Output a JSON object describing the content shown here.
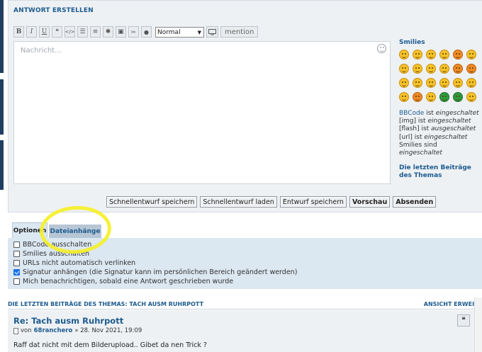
{
  "panel": {
    "title": "ANTWORT ERSTELLEN"
  },
  "toolbar": {
    "buttons": [
      {
        "label": "B",
        "icon": "bold"
      },
      {
        "label": "I",
        "icon": "italic"
      },
      {
        "label": "U",
        "icon": "underline"
      },
      {
        "label": "❝",
        "icon": "quote"
      },
      {
        "label": "</>",
        "icon": "code"
      },
      {
        "label": "☰",
        "icon": "list-bullet"
      },
      {
        "label": "≡",
        "icon": "list-numbered"
      },
      {
        "label": "✱",
        "icon": "star"
      },
      {
        "label": "▣",
        "icon": "image"
      },
      {
        "label": "✂",
        "icon": "link"
      },
      {
        "label": "●",
        "icon": "color-drop"
      }
    ],
    "font_size_value": "Normal",
    "mention_label": "mention"
  },
  "editor": {
    "placeholder": "Nachricht..."
  },
  "sidebar": {
    "smilies_title": "Smilies",
    "bbcode_link": "BBCode",
    "bbcode_line_a": " ist ",
    "bbcode_state": "eingeschaltet",
    "img_line": "[img] ist ",
    "img_state": "eingeschaltet",
    "flash_line": "[flash] ist ",
    "flash_state": "ausgeschaltet",
    "url_line": "[url] ist ",
    "url_state": "eingeschaltet",
    "smilies_line": "Smilies sind ",
    "smilies_state": "eingeschaltet",
    "recent_posts_link": "Die letzten Beiträge des Themas"
  },
  "buttons": {
    "quick_save": "Schnellentwurf speichern",
    "quick_load": "Schnellentwurf laden",
    "draft_save": "Entwurf speichern",
    "preview": "Vorschau",
    "submit": "Absenden"
  },
  "tabs": {
    "options": "Optionen",
    "attachments": "Dateianhänge"
  },
  "options": [
    {
      "label": "BBCode ausschalten",
      "checked": false
    },
    {
      "label": "Smilies ausschalten",
      "checked": false
    },
    {
      "label": "URLs nicht automatisch verlinken",
      "checked": false
    },
    {
      "label": "Signatur anhängen (die Signatur kann im persönlichen Bereich geändert werden)",
      "checked": true
    },
    {
      "label": "Mich benachrichtigen, sobald eine Antwort geschrieben wurde",
      "checked": false
    }
  ],
  "recent": {
    "heading": "DIE LETZTEN BEITRÄGE DES THEMAS: TACH AUSM RUHRPOTT",
    "view_extended": "ANSICHT ERWEITE",
    "post": {
      "title": "Re: Tach ausm Ruhrpott",
      "by": "von",
      "author": "68ranchero",
      "date": "» 28. Nov 2021, 19:09",
      "body": "Raff dat nicht mit dem Bilderupload.. Gibet da nen Trick ?",
      "quote_label": "❝"
    }
  },
  "colors": {
    "accent": "#1d5b8f",
    "highlight": "#f5f028",
    "panel": "#eef1f4",
    "options_bg": "#dbe7f1"
  }
}
